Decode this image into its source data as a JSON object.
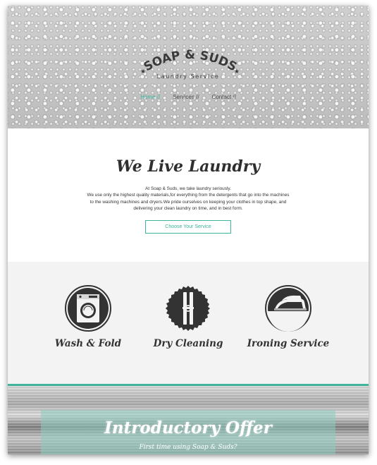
{
  "header": {
    "logo_title": "SOAP & SUDS",
    "logo_star": "★",
    "tagline": "Laundry Service",
    "nav": [
      {
        "label": "Home //",
        "active": true
      },
      {
        "label": "Services //",
        "active": false
      },
      {
        "label": "Contact //",
        "active": false
      }
    ]
  },
  "intro": {
    "heading": "We Live Laundry",
    "paragraph": "At Soap & Suds, we take laundry seriously.\nWe use only the highest quality materials,for everything from the detergents that go into the machines to the washing machines and dryers.We pride ourselves on keeping your clothes in top shape, and delivering your clean laundry on time, and in best form.",
    "cta_label": "Choose Your Service"
  },
  "services": [
    {
      "label": "Wash & Fold",
      "icon": "washing-machine-icon"
    },
    {
      "label": "Dry Cleaning",
      "icon": "clothespin-icon"
    },
    {
      "label": "Ironing Service",
      "icon": "iron-icon"
    }
  ],
  "offer": {
    "heading": "Introductory Offer",
    "subheading": "First time using Soap & Suds?"
  },
  "colors": {
    "accent": "#3fb39c",
    "dark": "#333333",
    "services_bg": "#f3f3f3"
  }
}
